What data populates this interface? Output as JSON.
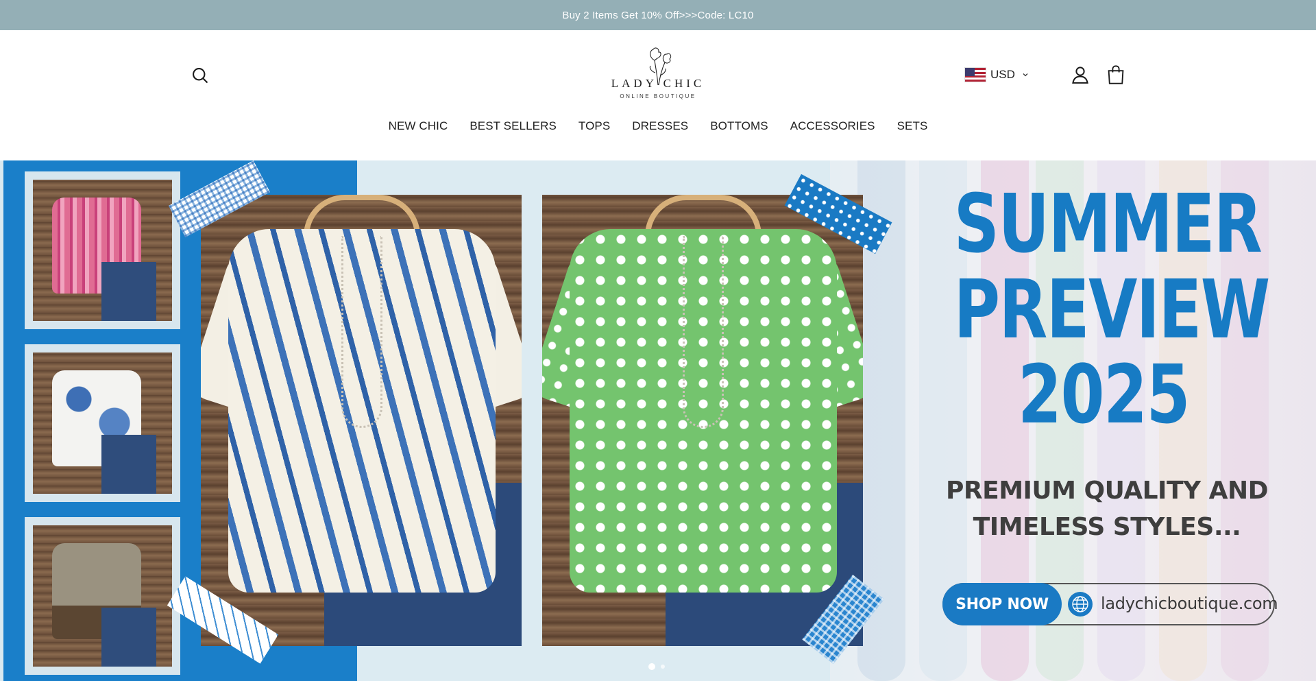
{
  "announcement": {
    "text": "Buy 2 Items Get 10% Off>>>Code: LC10"
  },
  "header": {
    "logo": {
      "name": "LADY   CHIC",
      "tagline": "ONLINE BOUTIQUE"
    },
    "currency": {
      "code": "USD",
      "flag": "us-flag-icon"
    },
    "icons": [
      "search-icon",
      "account-icon",
      "cart-icon",
      "chevron-down-icon"
    ]
  },
  "nav": {
    "items": [
      {
        "label": "NEW CHIC"
      },
      {
        "label": "BEST SELLERS"
      },
      {
        "label": "TOPS"
      },
      {
        "label": "DRESSES"
      },
      {
        "label": "BOTTOMS"
      },
      {
        "label": "ACCESSORIES"
      },
      {
        "label": "SETS"
      }
    ]
  },
  "hero": {
    "headline": {
      "line1": "SUMMER",
      "line2": "PREVIEW",
      "line3": "2025"
    },
    "subheadline": {
      "line1": "PREMIUM QUALITY AND",
      "line2": "TIMELESS STYLES..."
    },
    "cta": {
      "label": "SHOP NOW"
    },
    "website": "ladychicboutique.com",
    "slides": {
      "count": 2,
      "active": 1
    }
  },
  "colors": {
    "announcement_bg": "#94afb6",
    "brand_blue": "#177bc4",
    "text_dark": "#1f1f1f"
  }
}
